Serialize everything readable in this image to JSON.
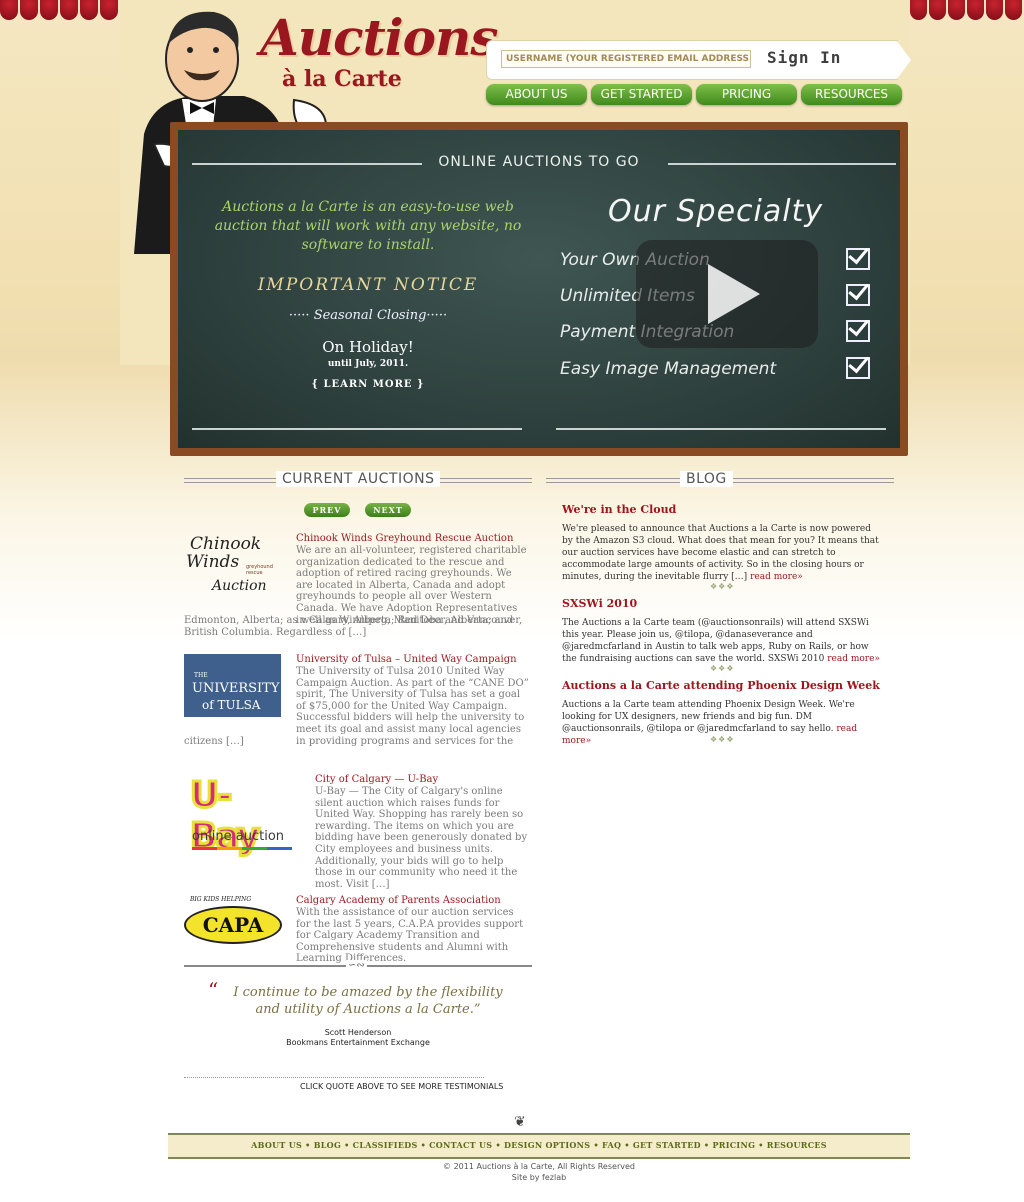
{
  "brand": {
    "line1": "Auctions",
    "line2": "à la Carte"
  },
  "signin": {
    "placeholder": "USERNAME (YOUR REGISTERED EMAIL ADDRESS)",
    "button": "Sign In"
  },
  "nav": [
    "ABOUT US",
    "GET STARTED",
    "PRICING",
    "RESOURCES"
  ],
  "board": {
    "title": "ONLINE AUCTIONS TO GO",
    "intro": "Auctions a la Carte is an easy-to-use web auction that will work with any website, no software to install.",
    "notice": "IMPORTANT NOTICE",
    "seasonal": "····· Seasonal Closing·····",
    "holiday": "On Holiday!",
    "until": "until July, 2011.",
    "learn_more": "{ LEARN MORE }",
    "specialty_title": "Our Specialty",
    "specialty": [
      "Your Own Auction",
      "Unlimited Items",
      "Payment Integration",
      "Easy Image Management"
    ]
  },
  "auctions": {
    "header": "CURRENT AUCTIONS",
    "prev": "PREV",
    "next": "NEXT",
    "items": [
      {
        "title": "Chinook Winds Greyhound Rescue Auction",
        "desc_a": "We are an all-volunteer, registered charitable organization dedicated to the rescue and adoption of retired racing greyhounds. We are located in Alberta, Canada and adopt greyhounds to people all over Western Canada. We have Adoption Representatives in Calgary, Alberta; Red Deer, Alberta; and",
        "desc_b": "Edmonton, Alberta; as well as Winnipeg, Manitoba and Vancouver, British Columbia. Regardless of […]",
        "logo_line1": "Chinook",
        "logo_line2": "Winds",
        "logo_sub": "greyhound rescue",
        "logo_line3": "Auction"
      },
      {
        "title": "University of Tulsa – United Way Campaign",
        "desc_a": "The University of Tulsa 2010 United Way Campaign Auction. As part of the “CANE DO” spirit, The University of Tulsa has set a goal of $75,000 for the United Way Campaign. Successful bidders will help the university to meet its goal and assist many local agencies in providing programs and services for the",
        "desc_b": "citizens […]",
        "logo_line1": "THE",
        "logo_line2": "UNIVERSITY",
        "logo_line3": "of TULSA"
      },
      {
        "title": "City of Calgary — U-Bay",
        "desc_a": "U-Bay — The City of Calgary's online silent auction which raises funds for United Way. Shopping has rarely been so rewarding. The items on which you are bidding have been generously donated by City employees and business units. Additionally, your bids will go to help those in our community who need it the most. Visit […]",
        "logo_line1": "U-Bay",
        "logo_line2": "online auction"
      },
      {
        "title": "Calgary Academy of Parents Association",
        "desc_a": "With the assistance of our auction services for the last 5 years, C.A.P.A provides support for Calgary Academy Transition and Comprehensive students and Alumni with Learning Differences.",
        "logo_line1": "BIG KIDS HELPING",
        "logo_line2": "CAPA"
      }
    ]
  },
  "testimonial": {
    "mark": "“",
    "quote": "I continue to be amazed by the flexibility and utility of Auctions a la Carte.”",
    "name": "Scott Henderson",
    "company": "Bookmans Entertainment Exchange",
    "cta": "CLICK QUOTE ABOVE TO SEE MORE TESTIMONIALS"
  },
  "blog": {
    "header": "BLOG",
    "read_more": "read more»",
    "sep": "❖❖❖",
    "posts": [
      {
        "title": "We're in the Cloud",
        "body": "We're pleased to announce that Auctions a la Carte is now powered by the Amazon S3 cloud. What does that mean for you? It means that our auction services have become elastic and can stretch to accommodate large amounts of activity. So in the closing hours or minutes, during the inevitable flurry […]"
      },
      {
        "title": "SXSWi 2010",
        "body": "The Auctions a la Carte team (@auctionsonrails) will attend SXSWi this year. Please join us, @tilopa, @danaseverance and @jaredmcfarland in Austin to talk web apps, Ruby on Rails, or how the fundraising auctions can save the world. SXSWi 2010"
      },
      {
        "title": "Auctions a la Carte attending Phoenix Design Week",
        "body": "Auctions a la Carte team attending Phoenix Design Week. We're looking for UX designers, new friends and big fun. DM @auctionsonrails, @tilopa or @jaredmcfarland to say hello."
      }
    ]
  },
  "footer": {
    "links": [
      "ABOUT US",
      "BLOG",
      "CLASSIFIEDS",
      "CONTACT US",
      "DESIGN OPTIONS",
      "FAQ",
      "GET STARTED",
      "PRICING",
      "RESOURCES"
    ],
    "copyright": "© 2011 Auctions à la Carte, All Rights Reserved",
    "siteby": "Site by fezlab"
  },
  "colors": {
    "brand_red": "#9a1720",
    "nav_green": "#4f9a27",
    "board": "#2f4440",
    "frame": "#8a4a22"
  }
}
